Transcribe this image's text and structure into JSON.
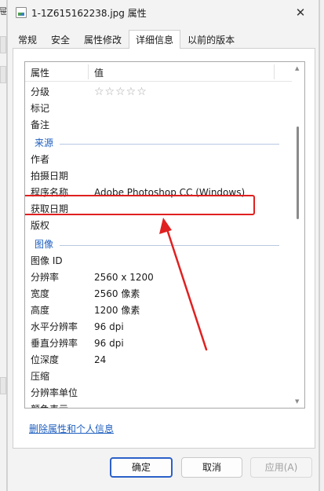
{
  "window": {
    "left_edge_glyph": "屉",
    "title": "1-1Z615162238.jpg 属性",
    "close_symbol": "✕"
  },
  "tabs": [
    {
      "label": "常规"
    },
    {
      "label": "安全"
    },
    {
      "label": "属性修改"
    },
    {
      "label": "详细信息",
      "active": true
    },
    {
      "label": "以前的版本"
    }
  ],
  "details": {
    "header_name": "属性",
    "header_value": "值",
    "rating_stars": "☆☆☆☆☆",
    "rows_top": [
      {
        "name": "分级",
        "value": ""
      },
      {
        "name": "标记",
        "value": ""
      },
      {
        "name": "备注",
        "value": ""
      }
    ],
    "group_source": "来源",
    "rows_source": [
      {
        "name": "作者",
        "value": ""
      },
      {
        "name": "拍摄日期",
        "value": ""
      },
      {
        "name": "程序名称",
        "value": "Adobe Photoshop CC (Windows)"
      },
      {
        "name": "获取日期",
        "value": ""
      },
      {
        "name": "版权",
        "value": ""
      }
    ],
    "group_image": "图像",
    "rows_image": [
      {
        "name": "图像 ID",
        "value": ""
      },
      {
        "name": "分辨率",
        "value": "2560 x 1200"
      },
      {
        "name": "宽度",
        "value": "2560 像素"
      },
      {
        "name": "高度",
        "value": "1200 像素"
      },
      {
        "name": "水平分辨率",
        "value": "96 dpi"
      },
      {
        "name": "垂直分辨率",
        "value": "96 dpi"
      },
      {
        "name": "位深度",
        "value": "24"
      },
      {
        "name": "压缩",
        "value": ""
      },
      {
        "name": "分辨率单位",
        "value": ""
      },
      {
        "name": "颜色表示",
        "value": ""
      }
    ]
  },
  "link_remove": "删除属性和个人信息",
  "buttons": {
    "ok": "确定",
    "cancel": "取消",
    "apply": "应用(A)"
  },
  "colors": {
    "highlight": "#e02020",
    "accent": "#1f5fbf"
  }
}
